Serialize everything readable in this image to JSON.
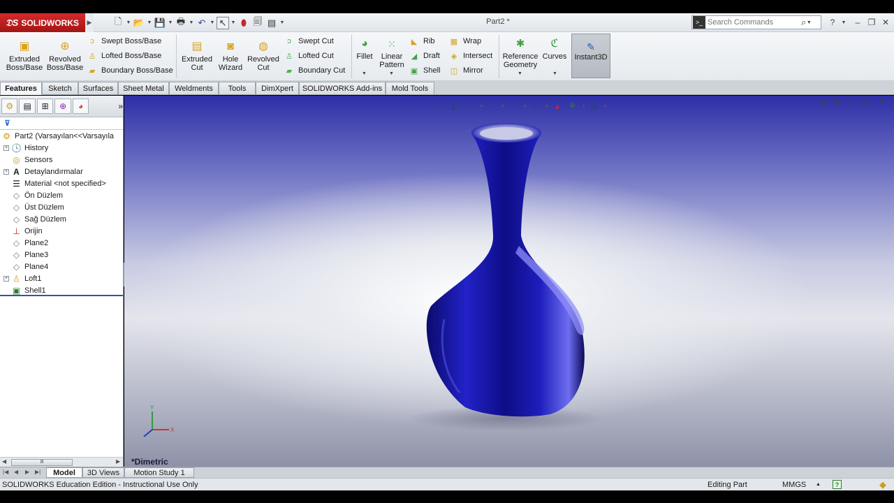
{
  "app": {
    "brand": "SOLIDWORKS",
    "document_title": "Part2 *"
  },
  "search": {
    "placeholder": "Search Commands"
  },
  "ribbon": {
    "extruded_boss": "Extruded Boss/Base",
    "revolved_boss": "Revolved Boss/Base",
    "swept_boss": "Swept Boss/Base",
    "lofted_boss": "Lofted Boss/Base",
    "boundary_boss": "Boundary Boss/Base",
    "extruded_cut": "Extruded Cut",
    "hole_wizard": "Hole Wizard",
    "revolved_cut": "Revolved Cut",
    "swept_cut": "Swept Cut",
    "lofted_cut": "Lofted Cut",
    "boundary_cut": "Boundary Cut",
    "fillet": "Fillet",
    "linear_pattern": "Linear Pattern",
    "rib": "Rib",
    "draft": "Draft",
    "shell": "Shell",
    "wrap": "Wrap",
    "intersect": "Intersect",
    "mirror": "Mirror",
    "reference_geometry": "Reference Geometry",
    "curves": "Curves",
    "instant3d": "Instant3D"
  },
  "command_tabs": [
    "Features",
    "Sketch",
    "Surfaces",
    "Sheet Metal",
    "Weldments",
    "Tools",
    "DimXpert",
    "SOLIDWORKS Add-ins",
    "Mold Tools"
  ],
  "feature_tree": {
    "root": "Part2  (Varsayılan<<Varsayıla",
    "items": [
      "History",
      "Sensors",
      "Detaylandırmalar",
      "Material <not specified>",
      "Ön Düzlem",
      "Üst Düzlem",
      "Sağ Düzlem",
      "Orijin",
      "Plane2",
      "Plane3",
      "Plane4",
      "Loft1",
      "Shell1"
    ]
  },
  "viewport": {
    "view_label": "*Dimetric",
    "triad_x": "X",
    "triad_y": "Y",
    "body_color": "#1c1cb8"
  },
  "bottom_tabs": [
    "Model",
    "3D Views",
    "Motion Study 1"
  ],
  "status": {
    "edition": "SOLIDWORKS Education Edition - Instructional Use Only",
    "mode": "Editing Part",
    "units": "MMGS"
  }
}
